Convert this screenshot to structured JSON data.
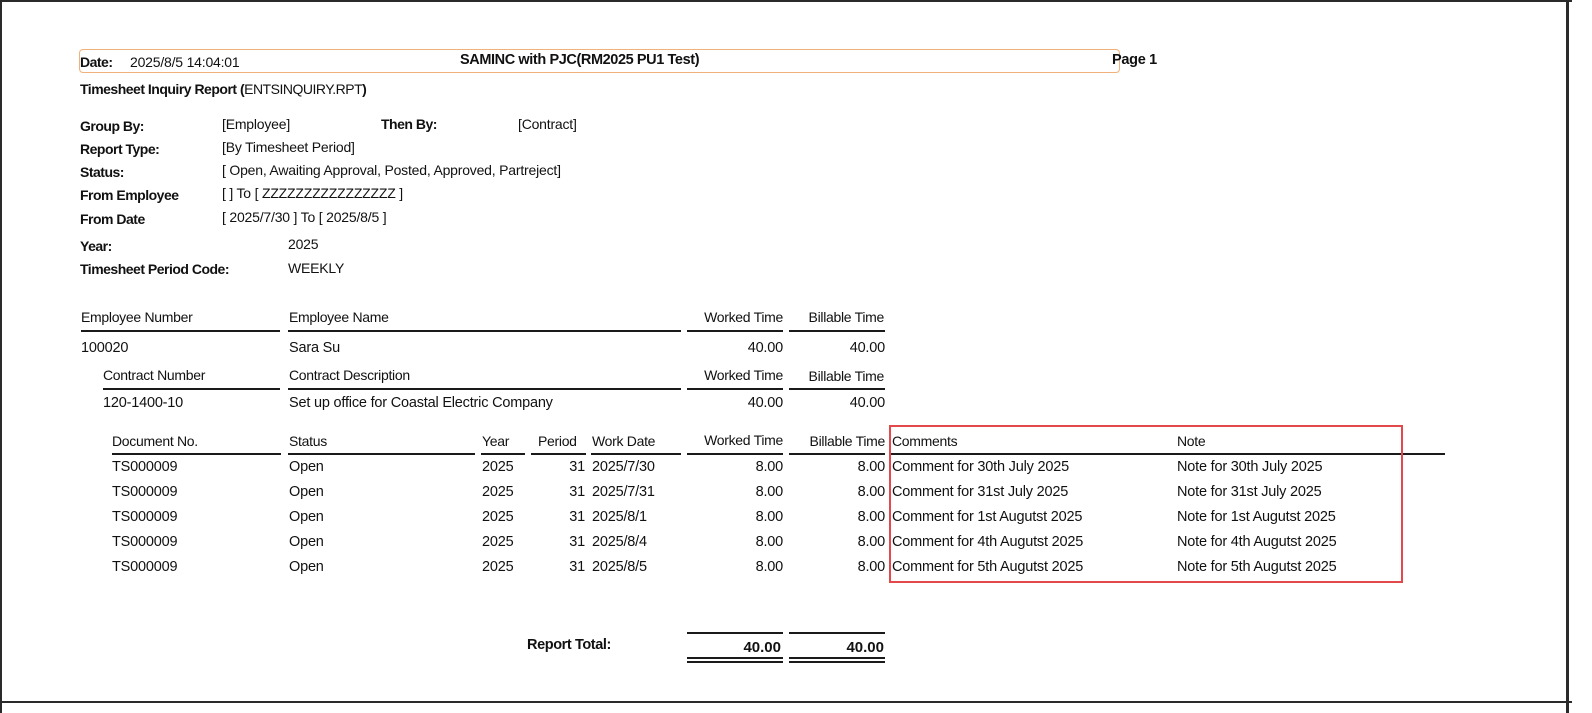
{
  "header": {
    "date_label": "Date:",
    "date_value": "2025/8/5  14:04:01",
    "company": "SAMINC with PJC(RM2025 PU1 Test)",
    "page": "Page 1",
    "report_title_bold": "Timesheet Inquiry Report (",
    "report_title_file": "ENTSINQUIRY.RPT",
    "report_title_close": ")"
  },
  "criteria": {
    "group_by_label": "Group By:",
    "group_by_value": "[Employee]",
    "then_by_label": "Then By:",
    "then_by_value": "[Contract]",
    "report_type_label": "Report Type:",
    "report_type_value": "[By Timesheet Period]",
    "status_label": "Status:",
    "status_value": "[ Open, Awaiting Approval, Posted, Approved, Partreject]",
    "from_employee_label": "From Employee",
    "from_employee_value": "[  ] To [ ZZZZZZZZZZZZZZZZ ]",
    "from_date_label": "From Date",
    "from_date_value": "[ 2025/7/30 ] To [ 2025/8/5 ]",
    "year_label": "Year:",
    "year_value": "2025",
    "period_code_label": "Timesheet Period Code:",
    "period_code_value": "WEEKLY"
  },
  "employee_headers": {
    "number": "Employee Number",
    "name": "Employee Name",
    "worked": "Worked Time",
    "billable": "Billable Time"
  },
  "employee": {
    "number": "100020",
    "name": "Sara Su",
    "worked": "40.00",
    "billable": "40.00"
  },
  "contract_headers": {
    "number": "Contract Number",
    "description": "Contract Description",
    "worked": "Worked Time",
    "billable": "Billable Time"
  },
  "contract": {
    "number": "120-1400-10",
    "description": "Set up office for Coastal Electric Company",
    "worked": "40.00",
    "billable": "40.00"
  },
  "detail_headers": {
    "document": "Document No.",
    "status": "Status",
    "year": "Year",
    "period": "Period",
    "work_date": "Work Date",
    "worked": "Worked Time",
    "billable": "Billable Time",
    "comments": "Comments",
    "note": "Note"
  },
  "rows": [
    {
      "document": "TS000009",
      "status": "Open",
      "year": "2025",
      "period": "31",
      "work_date": "2025/7/30",
      "worked": "8.00",
      "billable": "8.00",
      "comments": "Comment for 30th July 2025",
      "note": "Note for 30th July 2025"
    },
    {
      "document": "TS000009",
      "status": "Open",
      "year": "2025",
      "period": "31",
      "work_date": "2025/7/31",
      "worked": "8.00",
      "billable": "8.00",
      "comments": "Comment for 31st July 2025",
      "note": "Note for 31st July 2025"
    },
    {
      "document": "TS000009",
      "status": "Open",
      "year": "2025",
      "period": "31",
      "work_date": "2025/8/1",
      "worked": "8.00",
      "billable": "8.00",
      "comments": "Comment for 1st Augutst 2025",
      "note": "Note for 1st Augutst 2025"
    },
    {
      "document": "TS000009",
      "status": "Open",
      "year": "2025",
      "period": "31",
      "work_date": "2025/8/4",
      "worked": "8.00",
      "billable": "8.00",
      "comments": "Comment for 4th Augutst 2025",
      "note": "Note for 4th Augutst 2025"
    },
    {
      "document": "TS000009",
      "status": "Open",
      "year": "2025",
      "period": "31",
      "work_date": "2025/8/5",
      "worked": "8.00",
      "billable": "8.00",
      "comments": "Comment for 5th Augutst 2025",
      "note": "Note for 5th Augutst 2025"
    }
  ],
  "totals": {
    "label": "Report Total:",
    "worked": "40.00",
    "billable": "40.00"
  },
  "colors": {
    "highlight": "#e3484a",
    "title_box": "#f0b27a"
  }
}
